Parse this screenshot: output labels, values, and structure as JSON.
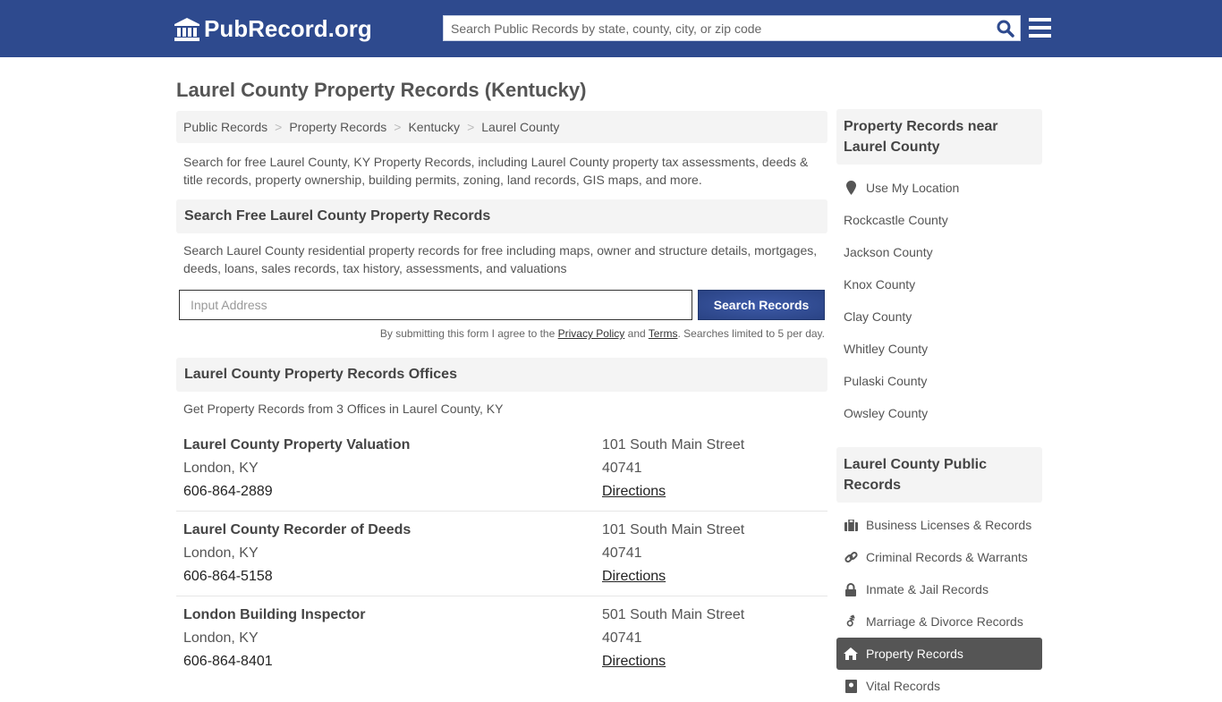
{
  "header": {
    "logo_text": "PubRecord.org",
    "search_placeholder": "Search Public Records by state, county, city, or zip code"
  },
  "page_title": "Laurel County Property Records (Kentucky)",
  "breadcrumb": [
    "Public Records",
    "Property Records",
    "Kentucky",
    "Laurel County"
  ],
  "intro": "Search for free Laurel County, KY Property Records, including Laurel County property tax assessments, deeds & title records, property ownership, building permits, zoning, land records, GIS maps, and more.",
  "search_section": {
    "heading": "Search Free Laurel County Property Records",
    "description": "Search Laurel County residential property records for free including maps, owner and structure details, mortgages, deeds, loans, sales records, tax history, assessments, and valuations",
    "input_placeholder": "Input Address",
    "button_label": "Search Records",
    "disclaimer_prefix": "By submitting this form I agree to the ",
    "privacy_link": "Privacy Policy",
    "and_text": " and ",
    "terms_link": "Terms",
    "disclaimer_suffix": ". Searches limited to 5 per day."
  },
  "offices_section": {
    "heading": "Laurel County Property Records Offices",
    "summary": "Get Property Records from 3 Offices in Laurel County, KY",
    "offices": [
      {
        "name": "Laurel County Property Valuation",
        "city": "London, KY",
        "phone": "606-864-2889",
        "street": "101 South Main Street",
        "zip": "40741",
        "directions": "Directions"
      },
      {
        "name": "Laurel County Recorder of Deeds",
        "city": "London, KY",
        "phone": "606-864-5158",
        "street": "101 South Main Street",
        "zip": "40741",
        "directions": "Directions"
      },
      {
        "name": "London Building Inspector",
        "city": "London, KY",
        "phone": "606-864-8401",
        "street": "501 South Main Street",
        "zip": "40741",
        "directions": "Directions"
      }
    ]
  },
  "sidebar": {
    "nearby_heading": "Property Records near Laurel County",
    "nearby_items": [
      "Use My Location",
      "Rockcastle County",
      "Jackson County",
      "Knox County",
      "Clay County",
      "Whitley County",
      "Pulaski County",
      "Owsley County"
    ],
    "public_heading": "Laurel County Public Records",
    "public_items": [
      {
        "label": "Business Licenses & Records",
        "icon": "briefcase-icon"
      },
      {
        "label": "Criminal Records & Warrants",
        "icon": "link-icon"
      },
      {
        "label": "Inmate & Jail Records",
        "icon": "lock-icon"
      },
      {
        "label": "Marriage & Divorce Records",
        "icon": "gender-icon"
      },
      {
        "label": "Property Records",
        "icon": "home-icon",
        "active": true
      },
      {
        "label": "Vital Records",
        "icon": "id-card-icon"
      }
    ]
  },
  "colors": {
    "brand": "#2e4a8e",
    "active_item": "#555555",
    "panel_bg": "#f4f4f4"
  }
}
